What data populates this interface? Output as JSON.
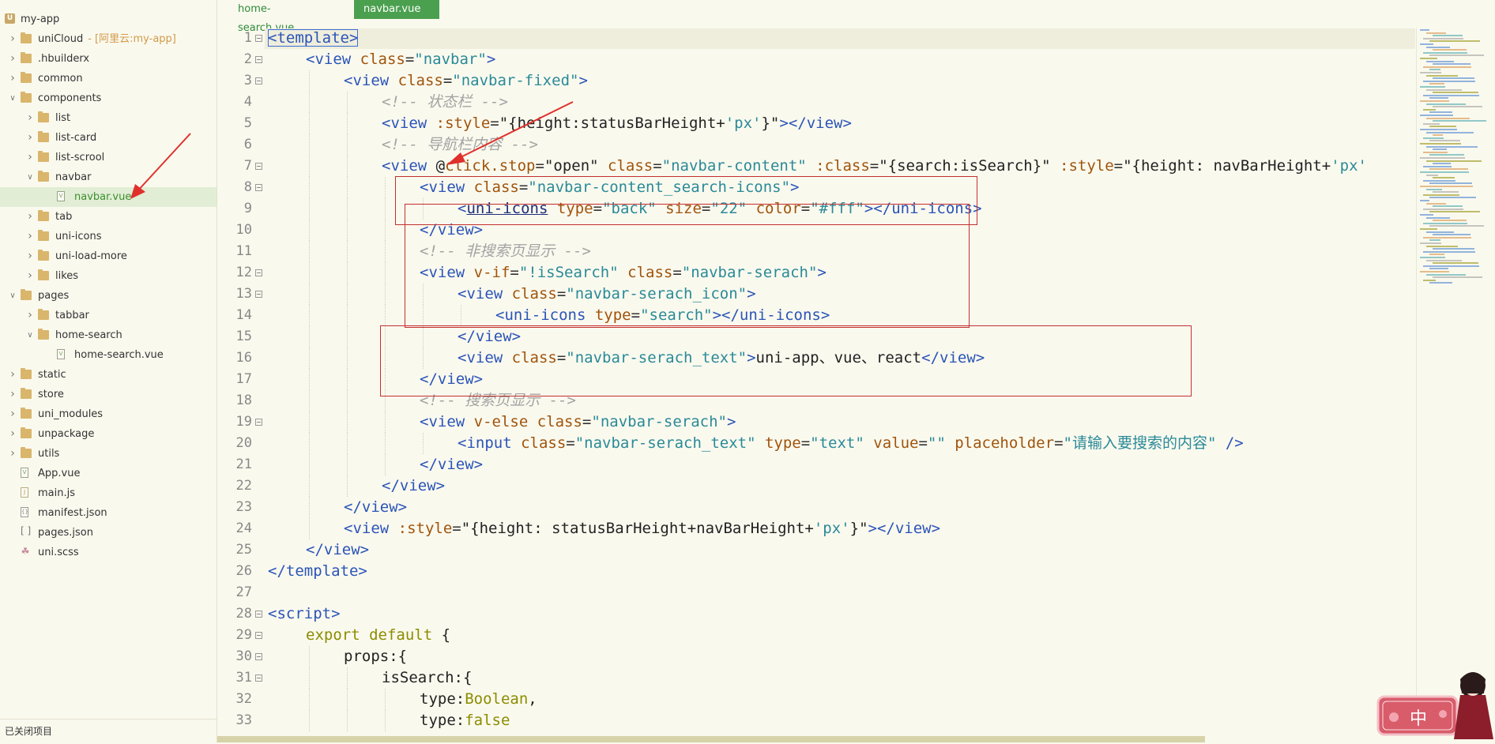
{
  "sidebar": {
    "project": {
      "name": "my-app"
    },
    "items": [
      {
        "label": "uniCloud",
        "suffix": "- [阿里云:my-app]",
        "type": "folder",
        "depth": 1,
        "expanded": false
      },
      {
        "label": ".hbuilderx",
        "type": "folder",
        "depth": 1,
        "expanded": false
      },
      {
        "label": "common",
        "type": "folder",
        "depth": 1,
        "expanded": false
      },
      {
        "label": "components",
        "type": "folder",
        "depth": 1,
        "expanded": true
      },
      {
        "label": "list",
        "type": "folder",
        "depth": 2,
        "expanded": false
      },
      {
        "label": "list-card",
        "type": "folder",
        "depth": 2,
        "expanded": false
      },
      {
        "label": "list-scrool",
        "type": "folder",
        "depth": 2,
        "expanded": false
      },
      {
        "label": "navbar",
        "type": "folder",
        "depth": 2,
        "expanded": true
      },
      {
        "label": "navbar.vue",
        "type": "vue",
        "depth": 3,
        "selected": true
      },
      {
        "label": "tab",
        "type": "folder",
        "depth": 2,
        "expanded": false
      },
      {
        "label": "uni-icons",
        "type": "folder",
        "depth": 2,
        "expanded": false
      },
      {
        "label": "uni-load-more",
        "type": "folder",
        "depth": 2,
        "expanded": false
      },
      {
        "label": "likes",
        "type": "folder",
        "depth": 2,
        "expanded": false
      },
      {
        "label": "pages",
        "type": "folder",
        "depth": 1,
        "expanded": true
      },
      {
        "label": "tabbar",
        "type": "folder",
        "depth": 2,
        "expanded": false
      },
      {
        "label": "home-search",
        "type": "folder",
        "depth": 2,
        "expanded": true
      },
      {
        "label": "home-search.vue",
        "type": "vue",
        "depth": 3
      },
      {
        "label": "static",
        "type": "folder",
        "depth": 1,
        "expanded": false
      },
      {
        "label": "store",
        "type": "folder",
        "depth": 1,
        "expanded": false
      },
      {
        "label": "uni_modules",
        "type": "folder",
        "depth": 1,
        "expanded": false
      },
      {
        "label": "unpackage",
        "type": "folder",
        "depth": 1,
        "expanded": false
      },
      {
        "label": "utils",
        "type": "folder",
        "depth": 1,
        "expanded": false
      },
      {
        "label": "App.vue",
        "type": "vue",
        "depth": 1
      },
      {
        "label": "main.js",
        "type": "js",
        "depth": 1
      },
      {
        "label": "manifest.json",
        "type": "json",
        "depth": 1
      },
      {
        "label": "pages.json",
        "type": "bracket",
        "depth": 1
      },
      {
        "label": "uni.scss",
        "type": "scss",
        "depth": 1
      }
    ],
    "footer": "已关闭项目"
  },
  "tabs": [
    {
      "label": "home-search.vue",
      "active": false
    },
    {
      "label": "navbar.vue",
      "active": true
    }
  ],
  "editor": {
    "current_line": 1,
    "lines": [
      {
        "n": 1,
        "fold": true,
        "indent": 0,
        "tokens": [
          [
            "tag-box",
            "<template>"
          ]
        ]
      },
      {
        "n": 2,
        "fold": true,
        "indent": 1,
        "tokens": [
          [
            "tag",
            "<view "
          ],
          [
            "attr",
            "class"
          ],
          [
            "punc",
            "="
          ],
          [
            "str",
            "\"navbar\""
          ],
          [
            "tag",
            ">"
          ]
        ]
      },
      {
        "n": 3,
        "fold": true,
        "indent": 2,
        "tokens": [
          [
            "tag",
            "<view "
          ],
          [
            "attr",
            "class"
          ],
          [
            "punc",
            "="
          ],
          [
            "str",
            "\"navbar-fixed\""
          ],
          [
            "tag",
            ">"
          ]
        ]
      },
      {
        "n": 4,
        "fold": false,
        "indent": 3,
        "tokens": [
          [
            "cmt",
            "<!-- 状态栏 -->"
          ]
        ]
      },
      {
        "n": 5,
        "fold": false,
        "indent": 3,
        "tokens": [
          [
            "tag",
            "<view "
          ],
          [
            "attr",
            ":style"
          ],
          [
            "punc",
            "="
          ],
          [
            "plain",
            "\"{height:statusBarHeight+"
          ],
          [
            "str",
            "'px'"
          ],
          [
            "plain",
            "}\""
          ],
          [
            "tag",
            "></view>"
          ]
        ]
      },
      {
        "n": 6,
        "fold": false,
        "indent": 3,
        "tokens": [
          [
            "cmt",
            "<!-- 导航栏内容 -->"
          ]
        ]
      },
      {
        "n": 7,
        "fold": true,
        "indent": 3,
        "tokens": [
          [
            "tag",
            "<view "
          ],
          [
            "plain",
            "@"
          ],
          [
            "attr",
            "click.stop"
          ],
          [
            "punc",
            "="
          ],
          [
            "plain",
            "\"open\" "
          ],
          [
            "attr",
            "class"
          ],
          [
            "punc",
            "="
          ],
          [
            "str",
            "\"navbar-content\" "
          ],
          [
            "attr",
            ":class"
          ],
          [
            "punc",
            "="
          ],
          [
            "plain",
            "\"{search:isSearch}\" "
          ],
          [
            "attr",
            ":style"
          ],
          [
            "punc",
            "="
          ],
          [
            "plain",
            "\"{height: navBarHeight+"
          ],
          [
            "str",
            "'px'"
          ]
        ]
      },
      {
        "n": 8,
        "fold": true,
        "indent": 4,
        "tokens": [
          [
            "tag",
            "<view "
          ],
          [
            "attr",
            "class"
          ],
          [
            "punc",
            "="
          ],
          [
            "str",
            "\"navbar-content_search-icons\""
          ],
          [
            "tag",
            ">"
          ]
        ]
      },
      {
        "n": 9,
        "fold": false,
        "indent": 5,
        "tokens": [
          [
            "tag",
            "<"
          ],
          [
            "link",
            "uni-icons"
          ],
          [
            "tag",
            " "
          ],
          [
            "attr",
            "type"
          ],
          [
            "punc",
            "="
          ],
          [
            "str",
            "\"back\" "
          ],
          [
            "attr",
            "size"
          ],
          [
            "punc",
            "="
          ],
          [
            "str",
            "\"22\" "
          ],
          [
            "attr",
            "color"
          ],
          [
            "punc",
            "="
          ],
          [
            "str",
            "\"#fff\""
          ],
          [
            "tag",
            "></uni-icons>"
          ]
        ]
      },
      {
        "n": 10,
        "fold": false,
        "indent": 4,
        "tokens": [
          [
            "tag",
            "</view>"
          ]
        ]
      },
      {
        "n": 11,
        "fold": false,
        "indent": 4,
        "tokens": [
          [
            "cmt",
            "<!-- 非搜索页显示 -->"
          ]
        ]
      },
      {
        "n": 12,
        "fold": true,
        "indent": 4,
        "tokens": [
          [
            "tag",
            "<view "
          ],
          [
            "attr",
            "v-if"
          ],
          [
            "punc",
            "="
          ],
          [
            "str",
            "\"!isSearch\" "
          ],
          [
            "attr",
            "class"
          ],
          [
            "punc",
            "="
          ],
          [
            "str",
            "\"navbar-serach\""
          ],
          [
            "tag",
            ">"
          ]
        ]
      },
      {
        "n": 13,
        "fold": true,
        "indent": 5,
        "tokens": [
          [
            "tag",
            "<view "
          ],
          [
            "attr",
            "class"
          ],
          [
            "punc",
            "="
          ],
          [
            "str",
            "\"navbar-serach_icon\""
          ],
          [
            "tag",
            ">"
          ]
        ]
      },
      {
        "n": 14,
        "fold": false,
        "indent": 6,
        "tokens": [
          [
            "tag",
            "<uni-icons "
          ],
          [
            "attr",
            "type"
          ],
          [
            "punc",
            "="
          ],
          [
            "str",
            "\"search\""
          ],
          [
            "tag",
            "></uni-icons>"
          ]
        ]
      },
      {
        "n": 15,
        "fold": false,
        "indent": 5,
        "tokens": [
          [
            "tag",
            "</view>"
          ]
        ]
      },
      {
        "n": 16,
        "fold": false,
        "indent": 5,
        "tokens": [
          [
            "tag",
            "<view "
          ],
          [
            "attr",
            "class"
          ],
          [
            "punc",
            "="
          ],
          [
            "str",
            "\"navbar-serach_text\""
          ],
          [
            "tag",
            ">"
          ],
          [
            "plain",
            "uni-app、vue、react"
          ],
          [
            "tag",
            "</view>"
          ]
        ]
      },
      {
        "n": 17,
        "fold": false,
        "indent": 4,
        "tokens": [
          [
            "tag",
            "</view>"
          ]
        ]
      },
      {
        "n": 18,
        "fold": false,
        "indent": 4,
        "tokens": [
          [
            "cmt",
            "<!-- 搜索页显示 -->"
          ]
        ]
      },
      {
        "n": 19,
        "fold": true,
        "indent": 4,
        "tokens": [
          [
            "tag",
            "<view "
          ],
          [
            "attr",
            "v-else "
          ],
          [
            "attr",
            "class"
          ],
          [
            "punc",
            "="
          ],
          [
            "str",
            "\"navbar-serach\""
          ],
          [
            "tag",
            ">"
          ]
        ]
      },
      {
        "n": 20,
        "fold": false,
        "indent": 5,
        "tokens": [
          [
            "tag",
            "<input "
          ],
          [
            "attr",
            "class"
          ],
          [
            "punc",
            "="
          ],
          [
            "str",
            "\"navbar-serach_text\" "
          ],
          [
            "attr",
            "type"
          ],
          [
            "punc",
            "="
          ],
          [
            "str",
            "\"text\" "
          ],
          [
            "attr",
            "value"
          ],
          [
            "punc",
            "="
          ],
          [
            "str",
            "\"\" "
          ],
          [
            "attr",
            "placeholder"
          ],
          [
            "punc",
            "="
          ],
          [
            "str",
            "\"请输入要搜索的内容\" "
          ],
          [
            "tag",
            "/>"
          ]
        ]
      },
      {
        "n": 21,
        "fold": false,
        "indent": 4,
        "tokens": [
          [
            "tag",
            "</view>"
          ]
        ]
      },
      {
        "n": 22,
        "fold": false,
        "indent": 3,
        "tokens": [
          [
            "tag",
            "</view>"
          ]
        ]
      },
      {
        "n": 23,
        "fold": false,
        "indent": 2,
        "tokens": [
          [
            "tag",
            "</view>"
          ]
        ]
      },
      {
        "n": 24,
        "fold": false,
        "indent": 2,
        "tokens": [
          [
            "tag",
            "<view "
          ],
          [
            "attr",
            ":style"
          ],
          [
            "punc",
            "="
          ],
          [
            "plain",
            "\"{height: statusBarHeight+navBarHeight+"
          ],
          [
            "str",
            "'px'"
          ],
          [
            "plain",
            "}\""
          ],
          [
            "tag",
            "></view>"
          ]
        ]
      },
      {
        "n": 25,
        "fold": false,
        "indent": 1,
        "tokens": [
          [
            "tag",
            "</view>"
          ]
        ]
      },
      {
        "n": 26,
        "fold": false,
        "indent": 0,
        "tokens": [
          [
            "tag",
            "</template>"
          ]
        ]
      },
      {
        "n": 27,
        "fold": false,
        "indent": 0,
        "tokens": []
      },
      {
        "n": 28,
        "fold": true,
        "indent": 0,
        "tokens": [
          [
            "tag",
            "<script>"
          ]
        ]
      },
      {
        "n": 29,
        "fold": true,
        "indent": 1,
        "tokens": [
          [
            "kw",
            "export default "
          ],
          [
            "plain",
            "{"
          ]
        ]
      },
      {
        "n": 30,
        "fold": true,
        "indent": 2,
        "tokens": [
          [
            "plain",
            "props:{"
          ]
        ]
      },
      {
        "n": 31,
        "fold": true,
        "indent": 3,
        "tokens": [
          [
            "plain",
            "isSearch:{"
          ]
        ]
      },
      {
        "n": 32,
        "fold": false,
        "indent": 4,
        "tokens": [
          [
            "plain",
            "type:"
          ],
          [
            "bool",
            "Boolean"
          ],
          [
            "plain",
            ","
          ]
        ]
      },
      {
        "n": 33,
        "fold": false,
        "indent": 4,
        "tokens": [
          [
            "plain",
            "type:"
          ],
          [
            "bool",
            "false"
          ]
        ]
      }
    ]
  },
  "colors": {
    "background": "#FAF9EE",
    "tab_active": "#4BA04F",
    "selected_row": "#E1EED5",
    "annotation_red": "#C2302F",
    "tag": "#2A54B8",
    "attr": "#A0540C",
    "string": "#2A8A98",
    "comment": "#A3A3A3"
  },
  "mascot": {
    "label": "中"
  }
}
